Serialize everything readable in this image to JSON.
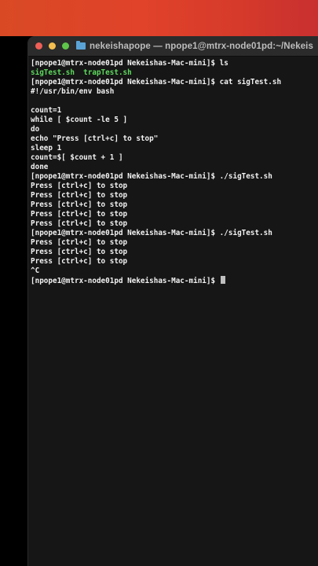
{
  "window": {
    "title": "nekeishapope — npope1@mtrx-node01pd:~/Nekeis",
    "folder_icon": "folder-icon"
  },
  "terminal": {
    "lines": [
      {
        "text": "[npope1@mtrx-node01pd Nekeishas-Mac-mini]$ ls",
        "kind": "prompt"
      },
      {
        "text": "sigTest.sh  trapTest.sh",
        "kind": "ls-out"
      },
      {
        "text": "[npope1@mtrx-node01pd Nekeishas-Mac-mini]$ cat sigTest.sh",
        "kind": "prompt"
      },
      {
        "text": "#!/usr/bin/env bash",
        "kind": "output"
      },
      {
        "text": "",
        "kind": "output"
      },
      {
        "text": "count=1",
        "kind": "output"
      },
      {
        "text": "while [ $count -le 5 ]",
        "kind": "output"
      },
      {
        "text": "do",
        "kind": "output"
      },
      {
        "text": "echo \"Press [ctrl+c] to stop\"",
        "kind": "output"
      },
      {
        "text": "sleep 1",
        "kind": "output"
      },
      {
        "text": "count=$[ $count + 1 ]",
        "kind": "output"
      },
      {
        "text": "done",
        "kind": "output"
      },
      {
        "text": "[npope1@mtrx-node01pd Nekeishas-Mac-mini]$ ./sigTest.sh",
        "kind": "prompt"
      },
      {
        "text": "Press [ctrl+c] to stop",
        "kind": "output"
      },
      {
        "text": "Press [ctrl+c] to stop",
        "kind": "output"
      },
      {
        "text": "Press [ctrl+c] to stop",
        "kind": "output"
      },
      {
        "text": "Press [ctrl+c] to stop",
        "kind": "output"
      },
      {
        "text": "Press [ctrl+c] to stop",
        "kind": "output"
      },
      {
        "text": "[npope1@mtrx-node01pd Nekeishas-Mac-mini]$ ./sigTest.sh",
        "kind": "prompt"
      },
      {
        "text": "Press [ctrl+c] to stop",
        "kind": "output"
      },
      {
        "text": "Press [ctrl+c] to stop",
        "kind": "output"
      },
      {
        "text": "Press [ctrl+c] to stop",
        "kind": "output"
      },
      {
        "text": "^C",
        "kind": "output"
      },
      {
        "text": "[npope1@mtrx-node01pd Nekeishas-Mac-mini]$ ",
        "kind": "prompt-active"
      }
    ]
  },
  "colors": {
    "wallpaper": "#d94a24",
    "terminal_bg": "#161616",
    "ls_output": "#5dd95d",
    "text": "#f2f2f2"
  }
}
